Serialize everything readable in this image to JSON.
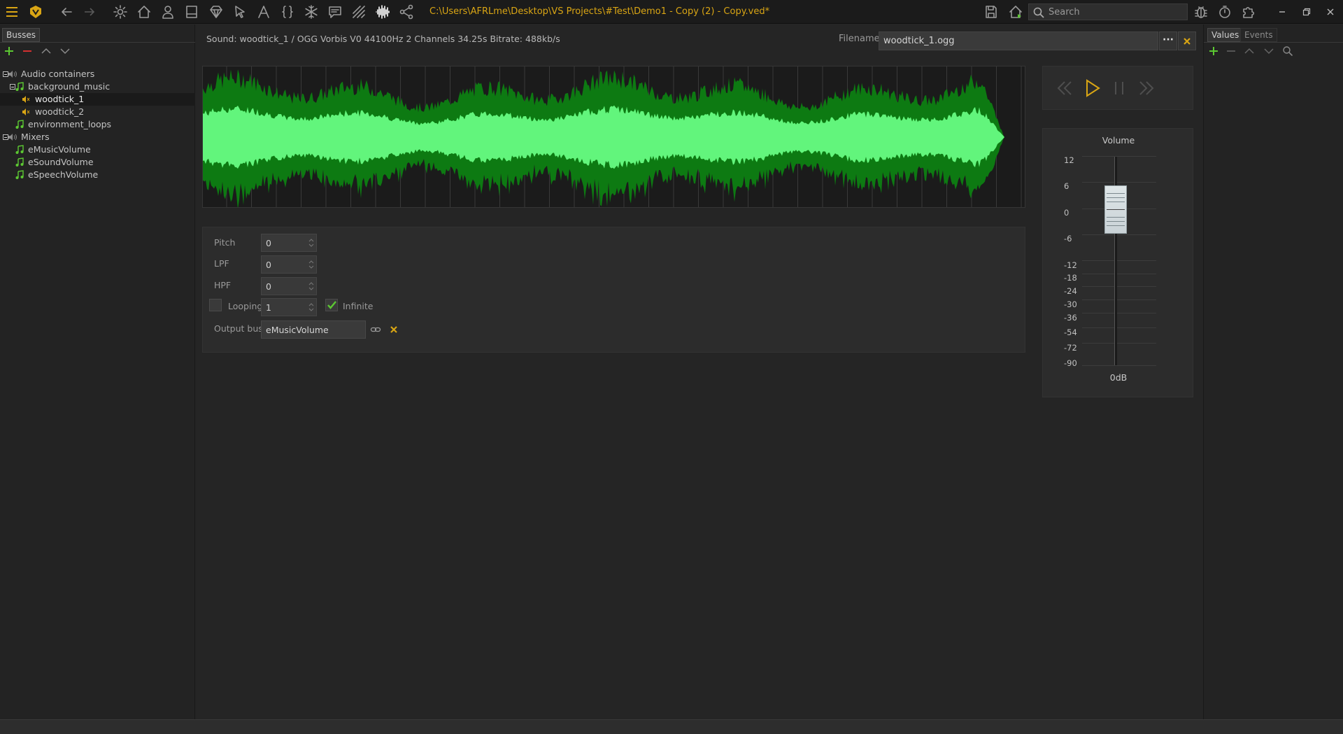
{
  "toolbar": {
    "project_path": "C:\\Users\\AFRLme\\Desktop\\VS Projects\\#Test\\Demo1 - Copy (2) - Copy.ved*",
    "search_placeholder": "Search"
  },
  "left_panel": {
    "tab": "Busses",
    "tree": [
      {
        "label": "Audio containers",
        "level": 0,
        "icon": "speaker-icon",
        "expanded": true
      },
      {
        "label": "background_music",
        "level": 1,
        "icon": "music-note-icon",
        "expanded": true
      },
      {
        "label": "woodtick_1",
        "level": 2,
        "icon": "sound-icon",
        "selected": true
      },
      {
        "label": "woodtick_2",
        "level": 2,
        "icon": "sound-icon"
      },
      {
        "label": "environment_loops",
        "level": 1,
        "icon": "music-note-icon"
      },
      {
        "label": "Mixers",
        "level": 0,
        "icon": "speaker-icon",
        "expanded": true
      },
      {
        "label": "eMusicVolume",
        "level": 1,
        "icon": "music-note-icon"
      },
      {
        "label": "eSoundVolume",
        "level": 1,
        "icon": "music-note-icon"
      },
      {
        "label": "eSpeechVolume",
        "level": 1,
        "icon": "music-note-icon"
      }
    ]
  },
  "sound": {
    "info": "Sound: woodtick_1 / OGG Vorbis V0 44100Hz 2 Channels 34.25s Bitrate: 488kb/s",
    "filename_label": "Filename",
    "filename": "woodtick_1.ogg",
    "browse_label": "···"
  },
  "properties": {
    "pitch": {
      "label": "Pitch",
      "value": "0"
    },
    "lpf": {
      "label": "LPF",
      "value": "0"
    },
    "hpf": {
      "label": "HPF",
      "value": "0"
    },
    "looping": {
      "label": "Looping",
      "value": "1",
      "checked": false
    },
    "infinite": {
      "label": "Infinite",
      "checked": true
    },
    "output_bus": {
      "label": "Output bus",
      "value": "eMusicVolume"
    }
  },
  "volume": {
    "title": "Volume",
    "ticks": [
      "12",
      "6",
      "0",
      "-6",
      "-12",
      "-18",
      "-24",
      "-30",
      "-36",
      "-54",
      "-72",
      "-90"
    ],
    "value": "0dB",
    "level_db": 0
  },
  "right_panel": {
    "tabs": [
      "Values",
      "Events"
    ]
  },
  "colors": {
    "accent": "#d9a514",
    "wave_dark": "#0d7a12",
    "wave_light": "#62f57c",
    "add_green": "#5cc832",
    "remove_red": "#d33030"
  }
}
